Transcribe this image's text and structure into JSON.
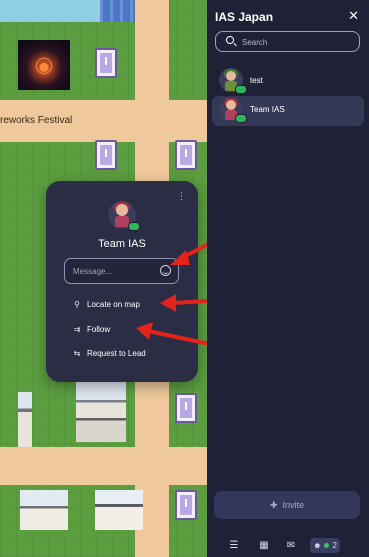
{
  "map": {
    "label": "reworks Festival"
  },
  "popup": {
    "name": "Team IAS",
    "message_placeholder": "Message...",
    "actions": [
      {
        "label": "Locate on map",
        "icon": "map-pin-icon"
      },
      {
        "label": "Follow",
        "icon": "follow-icon"
      },
      {
        "label": "Request to Lead",
        "icon": "lead-icon"
      }
    ]
  },
  "annotations": {
    "numbers": [
      "①",
      "②",
      "③"
    ],
    "color": "#e3241b"
  },
  "sidebar": {
    "title": "IAS Japan",
    "close_icon": "close-icon",
    "search_placeholder": "Search",
    "members": [
      {
        "name": "test"
      },
      {
        "name": "Team IAS",
        "selected": true
      }
    ],
    "invite_label": "Invite"
  },
  "bottom_bar": {
    "participant_count": "2",
    "icons": [
      "map-icon",
      "calendar-icon",
      "chat-icon",
      "participants-icon"
    ]
  },
  "colors": {
    "sidebar_bg": "#1f2236",
    "popup_bg": "#2a2d44",
    "selected_bg": "#343857",
    "online_green": "#38c466",
    "grass": "#5b9e3f",
    "road": "#efc99b"
  }
}
